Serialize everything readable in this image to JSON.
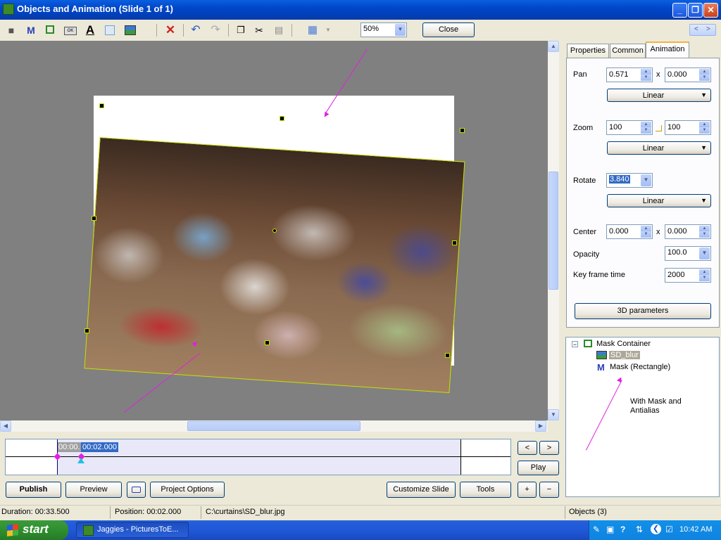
{
  "window": {
    "title": "Objects and Animation  (Slide 1 of 1)"
  },
  "toolbar": {
    "icons": [
      "camera-icon",
      "text-m-icon",
      "rectangle-icon",
      "ok-button-icon",
      "text-a-icon",
      "frame-icon",
      "image-icon",
      "delete-icon",
      "undo-icon",
      "redo-icon",
      "copy-icon",
      "cut-icon",
      "paste-icon",
      "grid-icon"
    ],
    "zoom_value": "50%",
    "close_label": "Close",
    "nav_prev": "<",
    "nav_next": ">"
  },
  "tabs": [
    {
      "label": "Properties"
    },
    {
      "label": "Common"
    },
    {
      "label": "Animation"
    }
  ],
  "animation": {
    "pan_label": "Pan",
    "pan_x": "0.571",
    "pan_y": "0.000",
    "pan_mode": "Linear",
    "zoom_label": "Zoom",
    "zoom_x": "100",
    "zoom_y": "100",
    "zoom_mode": "Linear",
    "rotate_label": "Rotate",
    "rotate_value": "3.840",
    "rotate_mode": "Linear",
    "center_label": "Center",
    "center_x": "0.000",
    "center_y": "0.000",
    "opacity_label": "Opacity",
    "opacity_value": "100.0",
    "keyframe_label": "Key frame time",
    "keyframe_value": "2000",
    "x_sep": "x",
    "params_button": "3D parameters"
  },
  "tree": {
    "root": "Mask Container",
    "children": [
      "SD_blur",
      "Mask (Rectangle)"
    ],
    "collapse_glyph": "−"
  },
  "annotation": {
    "line1": "With Mask and",
    "line2": "Antialias"
  },
  "timeline": {
    "start_time": "00:00.",
    "cursor_time": "00:02.000"
  },
  "buttons": {
    "prev": "<",
    "next": ">",
    "play": "Play",
    "publish": "Publish",
    "preview": "Preview",
    "project_options": "Project Options",
    "customize_slide": "Customize Slide",
    "tools": "Tools",
    "plus": "+",
    "minus": "−"
  },
  "status": {
    "duration": "Duration:  00:33.500",
    "position": "Position:  00:02.000",
    "path": "C:\\curtains\\SD_blur.jpg",
    "objects": "Objects (3)"
  },
  "taskbar": {
    "start_label": "start",
    "task_label": "Jaggies - PicturesToE...",
    "clock": "10:42 AM"
  },
  "colors": {
    "accent": "#0a5fe0",
    "arrow": "#e020e0",
    "tab_highlight": "#f5b43c"
  }
}
